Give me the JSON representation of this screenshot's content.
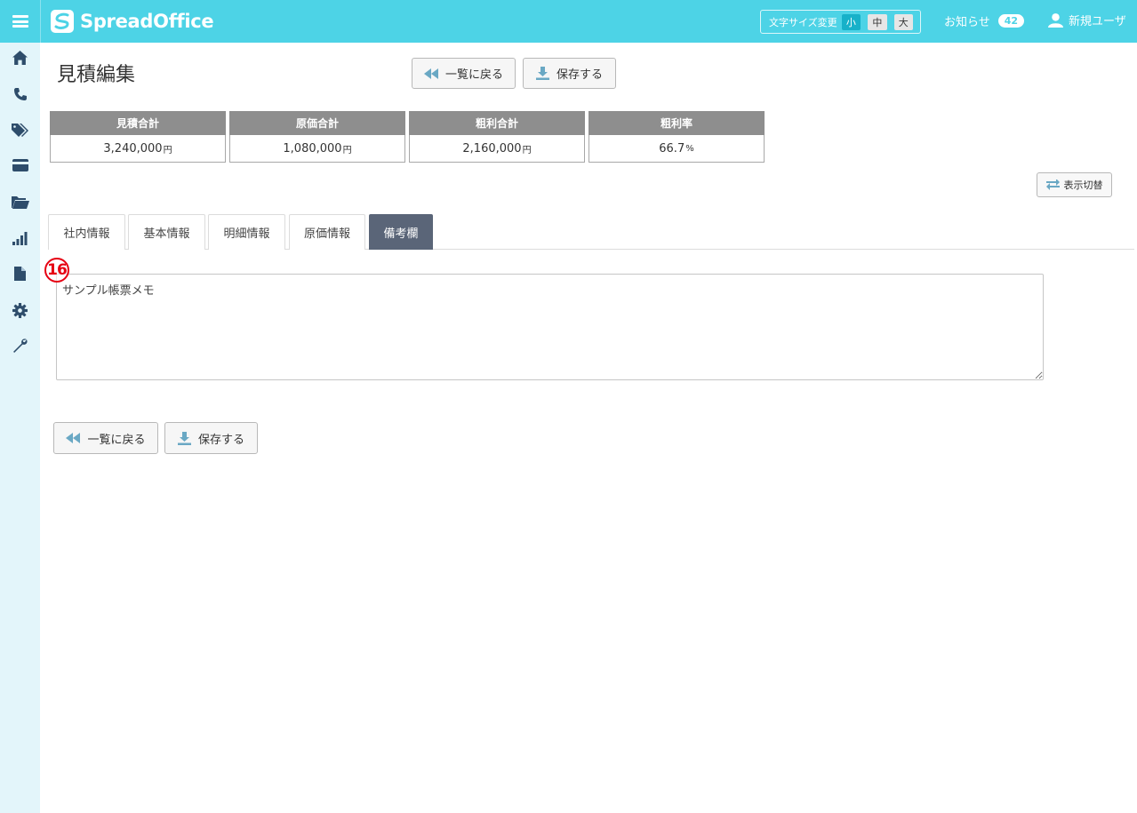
{
  "header": {
    "logo_text": "SpreadOffice",
    "font_size_label": "文字サイズ変更",
    "font_sizes": [
      "小",
      "中",
      "大"
    ],
    "notice_label": "お知らせ",
    "notice_count": "42",
    "user_name": "新規ユーザ"
  },
  "sidebar": {
    "icons": [
      "home-icon",
      "phone-icon",
      "tags-icon",
      "card-icon",
      "folder-icon",
      "chart-icon",
      "document-icon",
      "gear-icon",
      "wrench-icon"
    ]
  },
  "page": {
    "title": "見積編集",
    "back_label": "一覧に戻る",
    "save_label": "保存する",
    "toggle_label": "表示切替"
  },
  "summary": [
    {
      "label": "見積合計",
      "value": "3,240,000",
      "unit": "円"
    },
    {
      "label": "原価合計",
      "value": "1,080,000",
      "unit": "円"
    },
    {
      "label": "粗利合計",
      "value": "2,160,000",
      "unit": "円"
    },
    {
      "label": "粗利率",
      "value": "66.7",
      "unit": "%"
    }
  ],
  "tabs": [
    {
      "label": "社内情報"
    },
    {
      "label": "基本情報"
    },
    {
      "label": "明細情報"
    },
    {
      "label": "原価情報"
    },
    {
      "label": "備考欄"
    }
  ],
  "memo": {
    "marker": "16",
    "value": "サンプル帳票メモ"
  },
  "colors": {
    "header_bg": "#4dd3e6",
    "active_tab": "#5a6578",
    "sidebar_bg": "#e3f5fa",
    "marker": "#e60012"
  }
}
